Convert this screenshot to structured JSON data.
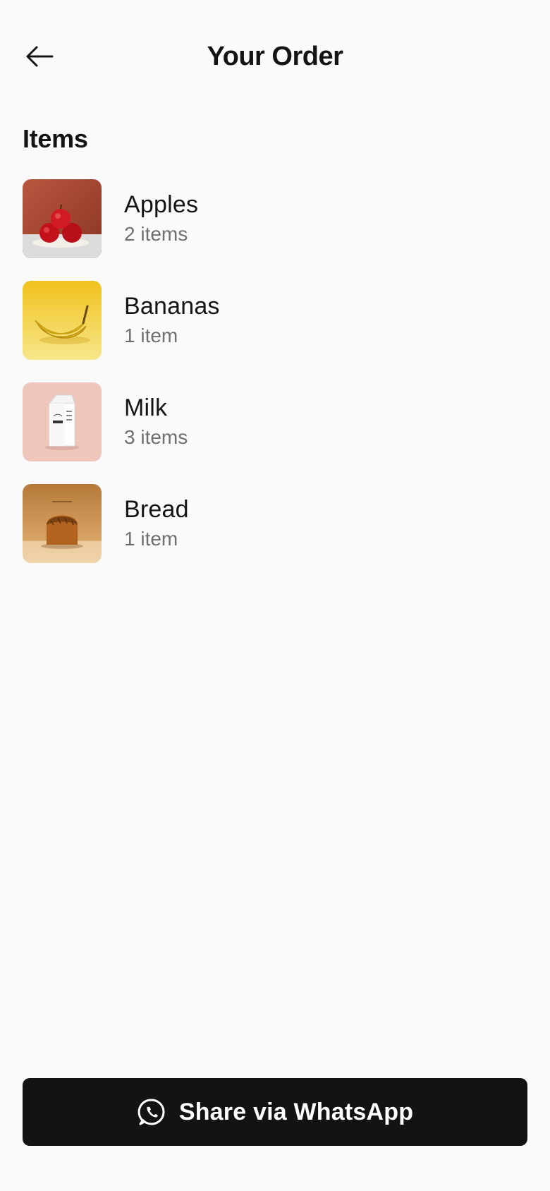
{
  "header": {
    "title": "Your Order",
    "back_icon": "arrow-left-icon"
  },
  "section": {
    "title": "Items"
  },
  "items": [
    {
      "name": "Apples",
      "quantity": "2 items",
      "image": "apples-image"
    },
    {
      "name": "Bananas",
      "quantity": "1 item",
      "image": "bananas-image"
    },
    {
      "name": "Milk",
      "quantity": "3 items",
      "image": "milk-carton-image"
    },
    {
      "name": "Bread",
      "quantity": "1 item",
      "image": "bread-loaf-image"
    }
  ],
  "share_button": {
    "label": "Share via WhatsApp",
    "icon": "whatsapp-icon"
  },
  "colors": {
    "background": "#fafafa",
    "text_primary": "#141414",
    "text_secondary": "#6f6f6f",
    "button_bg": "#131313",
    "button_text": "#ffffff"
  }
}
